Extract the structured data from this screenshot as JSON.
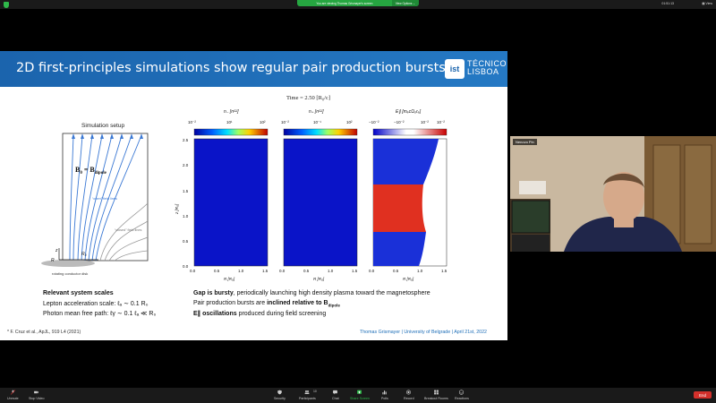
{
  "top_bar": {
    "share_banner": "You are viewing Thomas Grismayer's screen",
    "view_options": "View Options ⌄",
    "clock": "01:51:13",
    "view": "▦ View"
  },
  "slide": {
    "title": "2D first-principles simulations show regular pair production bursts",
    "logo_mark": "ist",
    "logo_line1": "TÉCNICO",
    "logo_line2": "LISBOA",
    "sim_setup_label": "Simulation setup",
    "diagram": {
      "b0_label": "B₀ = Bₑdipole",
      "b0_main": "B",
      "b0_sub0": "0",
      "b0_eq": " = B",
      "b0_subdip": "dipole",
      "open_lines": "“open” field lines",
      "closed_lines": "“closed” field lines",
      "z": "z",
      "r0": "R",
      "r0_sub": "0",
      "R": "R",
      "rotating": "rotating conductor disk"
    },
    "time_label": "Time = 2.50 [R₀/c]",
    "plots": {
      "titles": [
        "n₋ [nᴳᴶ]",
        "n₊ [nᴳᴶ]",
        "E∥ [mₑcΩ₀rₑ]"
      ],
      "cbar1_ticks": [
        "10⁻²",
        "10¹",
        "10²"
      ],
      "cbar1_ticks_alt": [
        "10⁻²",
        "10⁻¹",
        "10²"
      ],
      "cbar3_ticks": [
        "−10⁻²",
        "−10⁻²",
        "10⁻²",
        "10⁻²"
      ],
      "y_ticks": [
        "0.0",
        "0.5",
        "1.0",
        "1.5",
        "2.0",
        "2.5"
      ],
      "x_ticks": [
        "0.0",
        "0.5",
        "1.0",
        "1.5"
      ],
      "ylabel": "z [R₀]",
      "xlabel": "R [R₀]"
    },
    "left_text": {
      "heading": "Relevant system scales",
      "line1": "Lepton acceleration scale: ℓₐ ∼ 0.1 R₀",
      "line2": "Photon mean free path: ℓγ ∼ 0.1 ℓₐ ≪ R₀"
    },
    "right_text": {
      "l1_bold": "Gap is bursty",
      "l1_rest": ", periodically launching high density plasma toward the magnetosphere",
      "l2_pre": "Pair production bursts are ",
      "l2_bold": "inclined relative to B",
      "l2_sub": "dipole",
      "l3_bold": "E∥ oscillations",
      "l3_rest": " produced during field screening"
    },
    "footnote": "* F. Cruz et al., ApJL, 919 L4 (2021)",
    "footer_right": "Thomas Grismayer | University of Belgrade | April 21st, 2022"
  },
  "video": {
    "name": "Nenovo Pin"
  },
  "toolbar": {
    "items": [
      {
        "label": "Unmute",
        "icon": "microphone-muted-icon"
      },
      {
        "label": "Stop Video",
        "icon": "video-camera-icon"
      },
      {
        "label": "Security",
        "icon": "shield-icon"
      },
      {
        "label": "Participants",
        "icon": "participants-icon",
        "count": "10"
      },
      {
        "label": "Chat",
        "icon": "chat-icon"
      },
      {
        "label": "Share Screen",
        "icon": "share-screen-icon"
      },
      {
        "label": "Polls",
        "icon": "polls-icon"
      },
      {
        "label": "Record",
        "icon": "record-icon"
      },
      {
        "label": "Breakout Rooms",
        "icon": "breakout-rooms-icon"
      },
      {
        "label": "Reactions",
        "icon": "reactions-icon"
      }
    ],
    "end_label": "End"
  },
  "colors": {
    "accent": "#1f6fb8",
    "share_green": "#26a641",
    "end_red": "#d3302b"
  }
}
